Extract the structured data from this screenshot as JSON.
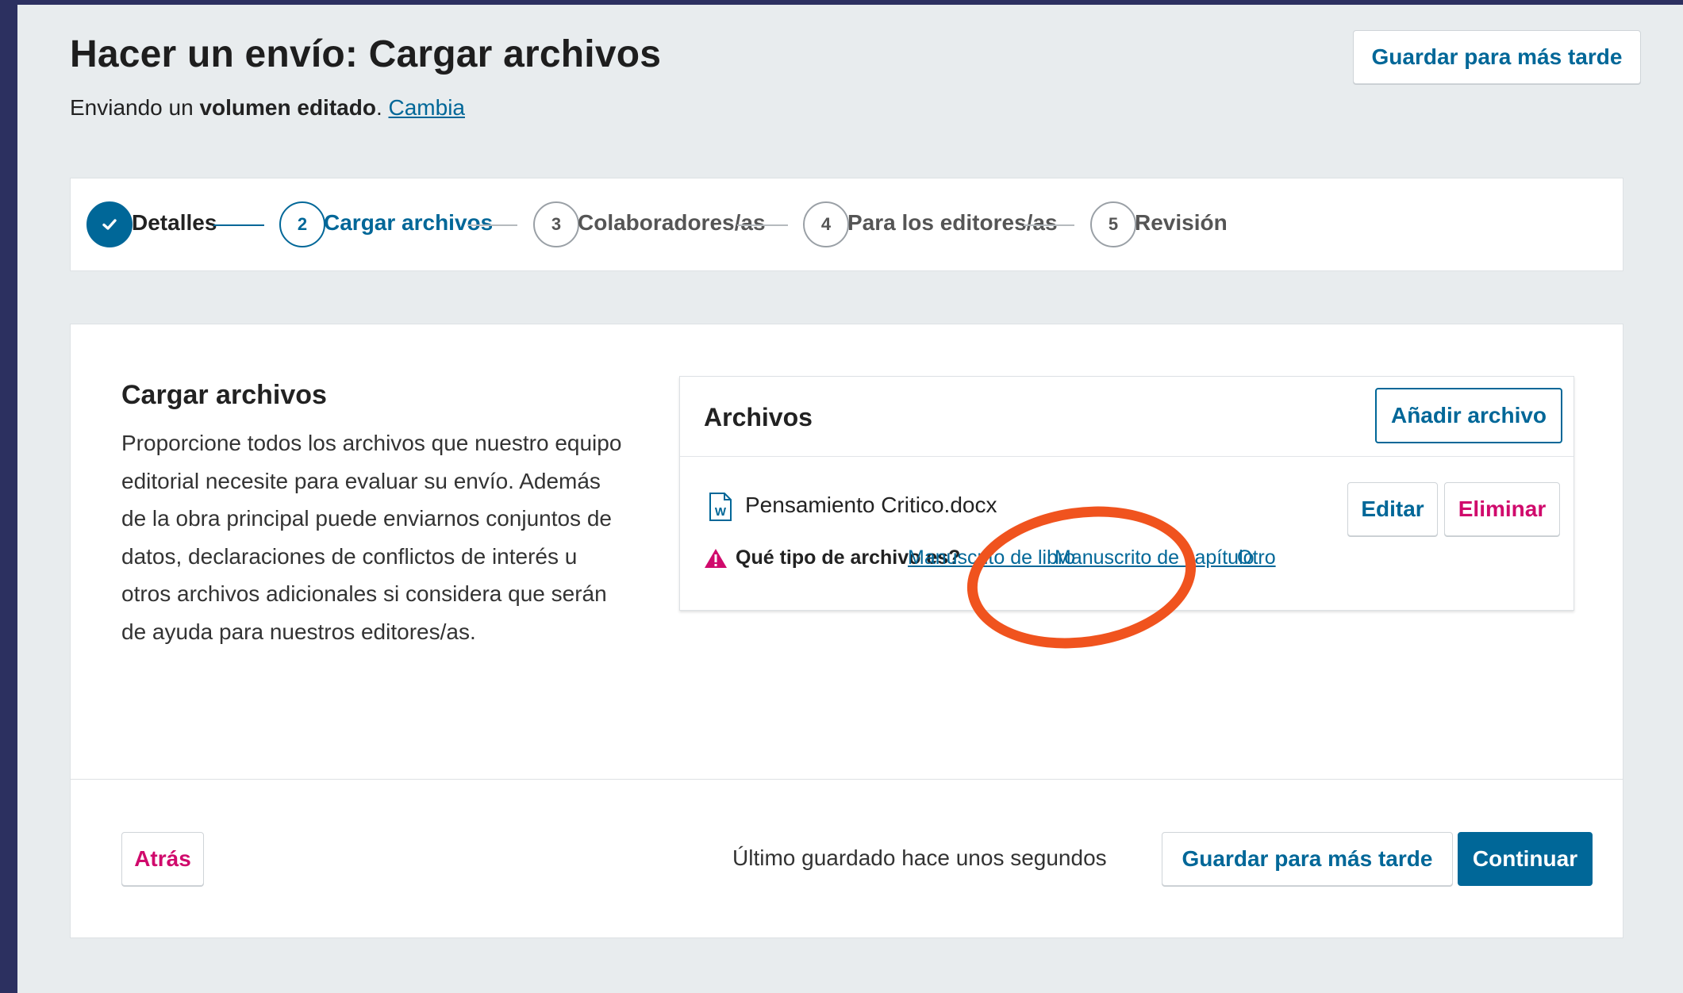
{
  "header": {
    "title": "Hacer un envío: Cargar archivos",
    "subtitle_prefix": "Enviando un ",
    "subtitle_bold": "volumen editado",
    "subtitle_suffix": ".",
    "change_link": "Cambia",
    "save_later": "Guardar para más tarde"
  },
  "steps": [
    {
      "number": "✓",
      "label": "Detalles",
      "state": "done"
    },
    {
      "number": "2",
      "label": "Cargar archivos",
      "state": "current"
    },
    {
      "number": "3",
      "label": "Colaboradores/as",
      "state": "pending"
    },
    {
      "number": "4",
      "label": "Para los editores/as",
      "state": "pending"
    },
    {
      "number": "5",
      "label": "Revisión",
      "state": "pending"
    }
  ],
  "upload": {
    "title": "Cargar archivos",
    "description": "Proporcione todos los archivos que nuestro equipo editorial necesite para evaluar su envío. Además de la obra principal puede enviarnos conjuntos de datos, declaraciones de conflictos de interés u otros archivos adicionales si considera que serán de ayuda para nuestros editores/as."
  },
  "files": {
    "title": "Archivos",
    "add_button": "Añadir archivo",
    "items": [
      {
        "name": "Pensamiento Critico.docx",
        "icon": "word-document-icon",
        "edit_label": "Editar",
        "delete_label": "Eliminar",
        "type_question": "Qué tipo de archivo es?",
        "type_options": [
          "Manuscrito de libro",
          "Manuscrito de capítulo",
          "Otro"
        ]
      }
    ]
  },
  "footer": {
    "back": "Atrás",
    "last_saved": "Último guardado hace unos segundos",
    "save_later": "Guardar para más tarde",
    "continue": "Continuar"
  },
  "colors": {
    "primary": "#006798",
    "danger": "#d00a6c",
    "annotation": "#f0531e",
    "page_bg": "#e8ecee",
    "outer_bg": "#2c3060"
  }
}
